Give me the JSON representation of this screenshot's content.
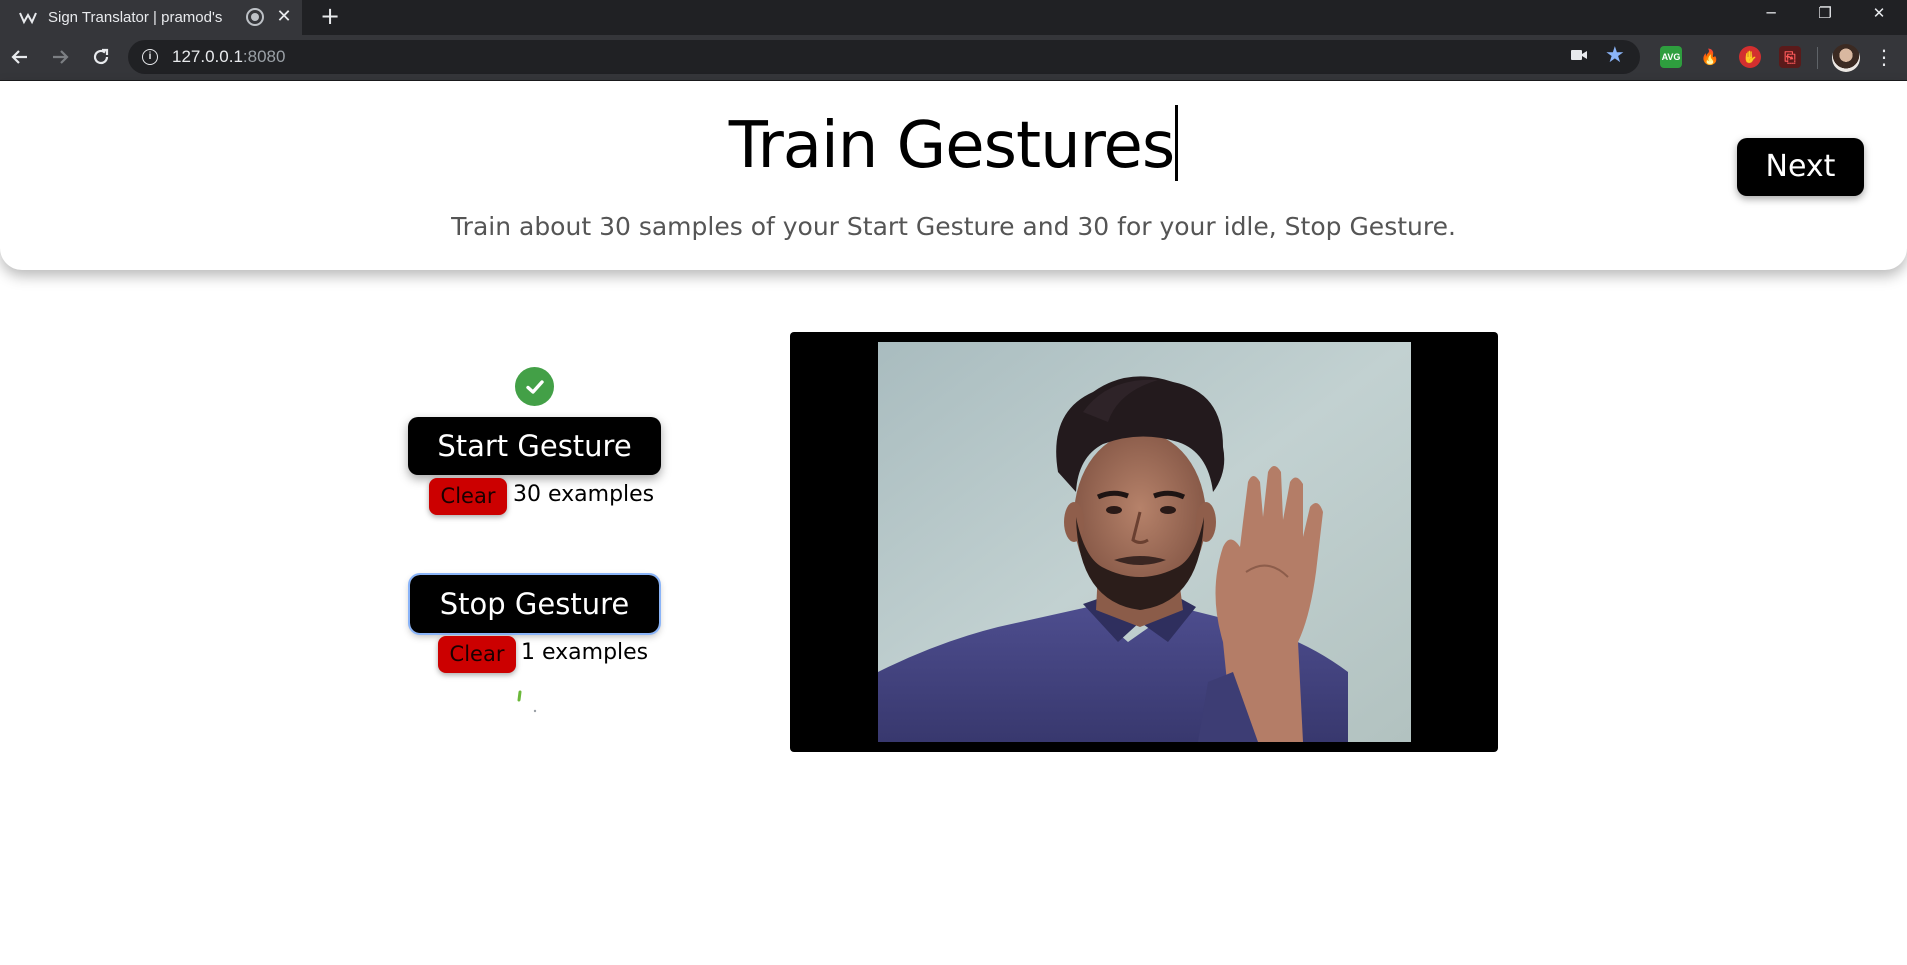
{
  "browser": {
    "tab_title": "Sign Translator | pramod's",
    "url_host": "127.0.0.1",
    "url_port": ":8080",
    "icons": [
      "back-icon",
      "forward-icon",
      "reload-icon",
      "info-icon",
      "camera-icon",
      "star-icon",
      "menu-icon"
    ]
  },
  "extensions": [
    {
      "name": "avg-extension",
      "label": "AVG",
      "color": "#2e9e3e"
    },
    {
      "name": "fire-extension",
      "label": "🔥",
      "color": "#35363a"
    },
    {
      "name": "stop-extension",
      "label": "✋",
      "color": "#d32f2f"
    },
    {
      "name": "pdf-extension",
      "label": "⎘",
      "color": "#5a1a1a"
    }
  ],
  "header": {
    "title": "Train Gestures",
    "subtitle": "Train about 30 samples of your Start Gesture and 30 for your idle, Stop Gesture.",
    "next_label": "Next"
  },
  "gestures": [
    {
      "label": "Start Gesture",
      "clear_label": "Clear",
      "count_text": "30 examples",
      "trained": true
    },
    {
      "label": "Stop Gesture",
      "clear_label": "Clear",
      "count_text": "1 examples",
      "trained": false
    }
  ],
  "colors": {
    "clear_button": "#cc0000",
    "check": "#43a047",
    "focus_outline": "#8ab4f8"
  }
}
